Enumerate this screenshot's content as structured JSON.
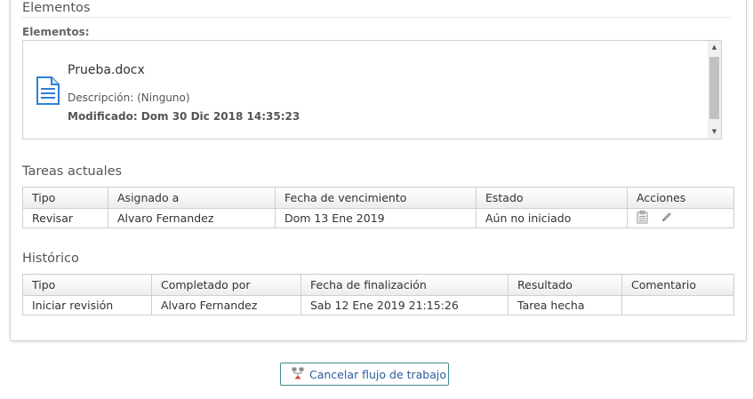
{
  "elements": {
    "section_title": "Elementos",
    "field_label": "Elementos:",
    "file": {
      "name": "Prueba.docx",
      "description": "Descripción: (Ninguno)",
      "modified": "Modificado: Dom 30 Dic 2018 14:35:23",
      "icon": "document-icon"
    }
  },
  "tasks": {
    "section_title": "Tareas actuales",
    "columns": [
      "Tipo",
      "Asignado a",
      "Fecha de vencimiento",
      "Estado",
      "Acciones"
    ],
    "rows": [
      {
        "tipo": "Revisar",
        "asignado": "Alvaro Fernandez",
        "vencimiento": "Dom 13 Ene 2019",
        "estado": "Aún no iniciado",
        "acciones": [
          "clipboard-icon",
          "pencil-icon"
        ]
      }
    ]
  },
  "history": {
    "section_title": "Histórico",
    "columns": [
      "Tipo",
      "Completado por",
      "Fecha de finalización",
      "Resultado",
      "Comentario"
    ],
    "rows": [
      {
        "tipo": "Iniciar revisión",
        "completado": "Alvaro Fernandez",
        "finalizacion": "Sab 12 Ene 2019 21:15:26",
        "resultado": "Tarea hecha",
        "comentario": ""
      }
    ]
  },
  "actions": {
    "cancel_label": "Cancelar flujo de trabajo"
  }
}
